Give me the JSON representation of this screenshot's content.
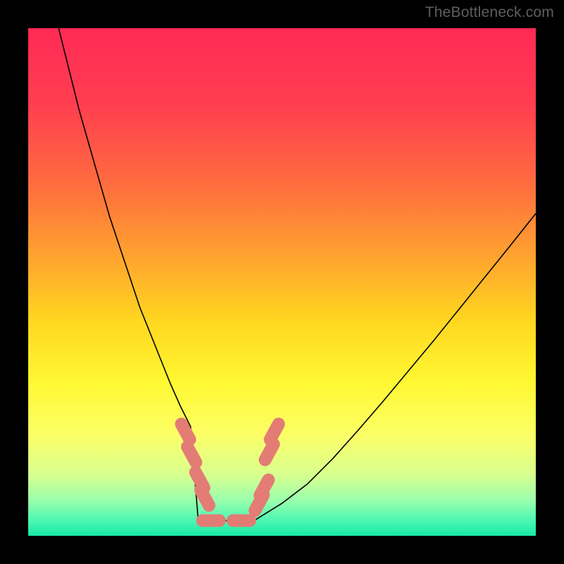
{
  "watermark": "TheBottleneck.com",
  "chart_data": {
    "type": "line",
    "title": "",
    "xlabel": "",
    "ylabel": "",
    "xlim": [
      0,
      100
    ],
    "ylim": [
      0,
      100
    ],
    "background_gradient_stops": [
      {
        "offset": 0.0,
        "color": "#ff2a55"
      },
      {
        "offset": 0.15,
        "color": "#ff3e50"
      },
      {
        "offset": 0.3,
        "color": "#ff6a3f"
      },
      {
        "offset": 0.45,
        "color": "#ffa32f"
      },
      {
        "offset": 0.58,
        "color": "#ffd81f"
      },
      {
        "offset": 0.7,
        "color": "#fff833"
      },
      {
        "offset": 0.8,
        "color": "#fcff66"
      },
      {
        "offset": 0.88,
        "color": "#d8ff8f"
      },
      {
        "offset": 0.93,
        "color": "#9affac"
      },
      {
        "offset": 0.97,
        "color": "#4cf7b3"
      },
      {
        "offset": 1.0,
        "color": "#17e9a6"
      }
    ],
    "series": [
      {
        "name": "curve",
        "color": "#000000",
        "width": 1.6,
        "x": [
          6,
          8,
          10,
          12,
          14,
          16,
          18,
          20,
          22,
          24,
          26,
          28,
          30,
          32,
          34,
          36,
          38,
          40,
          42,
          44,
          50,
          55,
          60,
          65,
          70,
          75,
          80,
          85,
          90,
          95,
          100
        ],
        "y": [
          100,
          92,
          84,
          77,
          70,
          63,
          57,
          51,
          45,
          40,
          35,
          30,
          25.5,
          21.5,
          18,
          14.5,
          11.5,
          9,
          6.8,
          5.2,
          6.4,
          10.2,
          15.2,
          20.8,
          26.6,
          32.6,
          38.6,
          44.8,
          51,
          57.2,
          63.5
        ]
      }
    ],
    "flat_region": {
      "x_start": 33.5,
      "x_end": 44.5,
      "y": 3.0
    },
    "markers": {
      "color": "#e37c75",
      "radius": 9,
      "points": [
        {
          "x": 31.0,
          "y": 20.5
        },
        {
          "x": 32.2,
          "y": 16.0
        },
        {
          "x": 33.8,
          "y": 11.0
        },
        {
          "x": 34.8,
          "y": 7.5
        },
        {
          "x": 36.0,
          "y": 3.0
        },
        {
          "x": 42.0,
          "y": 3.0
        },
        {
          "x": 45.5,
          "y": 6.5
        },
        {
          "x": 46.5,
          "y": 9.5
        },
        {
          "x": 47.5,
          "y": 16.5
        },
        {
          "x": 48.5,
          "y": 20.5
        }
      ]
    }
  }
}
